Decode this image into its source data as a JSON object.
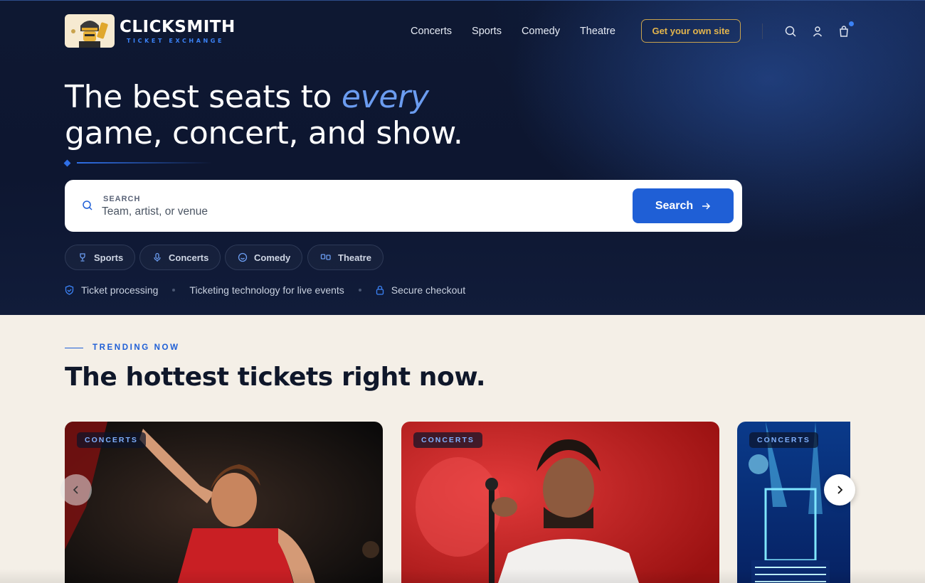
{
  "brand": {
    "name": "CLICKSMITH",
    "tagline": "TICKET EXCHANGE",
    "accent": "#1f5fd6",
    "gold": "#c9a34e"
  },
  "nav": {
    "items": [
      {
        "label": "Concerts"
      },
      {
        "label": "Sports"
      },
      {
        "label": "Comedy"
      },
      {
        "label": "Theatre"
      }
    ],
    "cta": "Get your own site",
    "icons": [
      "search-icon",
      "user-icon",
      "cart-icon"
    ]
  },
  "hero": {
    "headline_part1": "The best seats to ",
    "headline_accent": "every",
    "headline_part2": "game, concert, and show.",
    "search": {
      "label": "SEARCH",
      "placeholder": "Team, artist, or venue",
      "button": "Search"
    },
    "chips": [
      {
        "label": "Sports",
        "icon": "trophy-icon"
      },
      {
        "label": "Concerts",
        "icon": "microphone-icon"
      },
      {
        "label": "Comedy",
        "icon": "smiley-icon"
      },
      {
        "label": "Theatre",
        "icon": "theatre-icon"
      }
    ],
    "trust": [
      {
        "label": "Ticket processing",
        "icon": "shield-check-icon"
      },
      {
        "label": "Ticketing technology for live events"
      },
      {
        "label": "Secure checkout",
        "icon": "lock-icon"
      }
    ]
  },
  "trending": {
    "eyebrow": "TRENDING NOW",
    "title": "The hottest tickets right now.",
    "cards": [
      {
        "tag": "CONCERTS"
      },
      {
        "tag": "CONCERTS"
      },
      {
        "tag": "CONCERTS"
      }
    ]
  }
}
